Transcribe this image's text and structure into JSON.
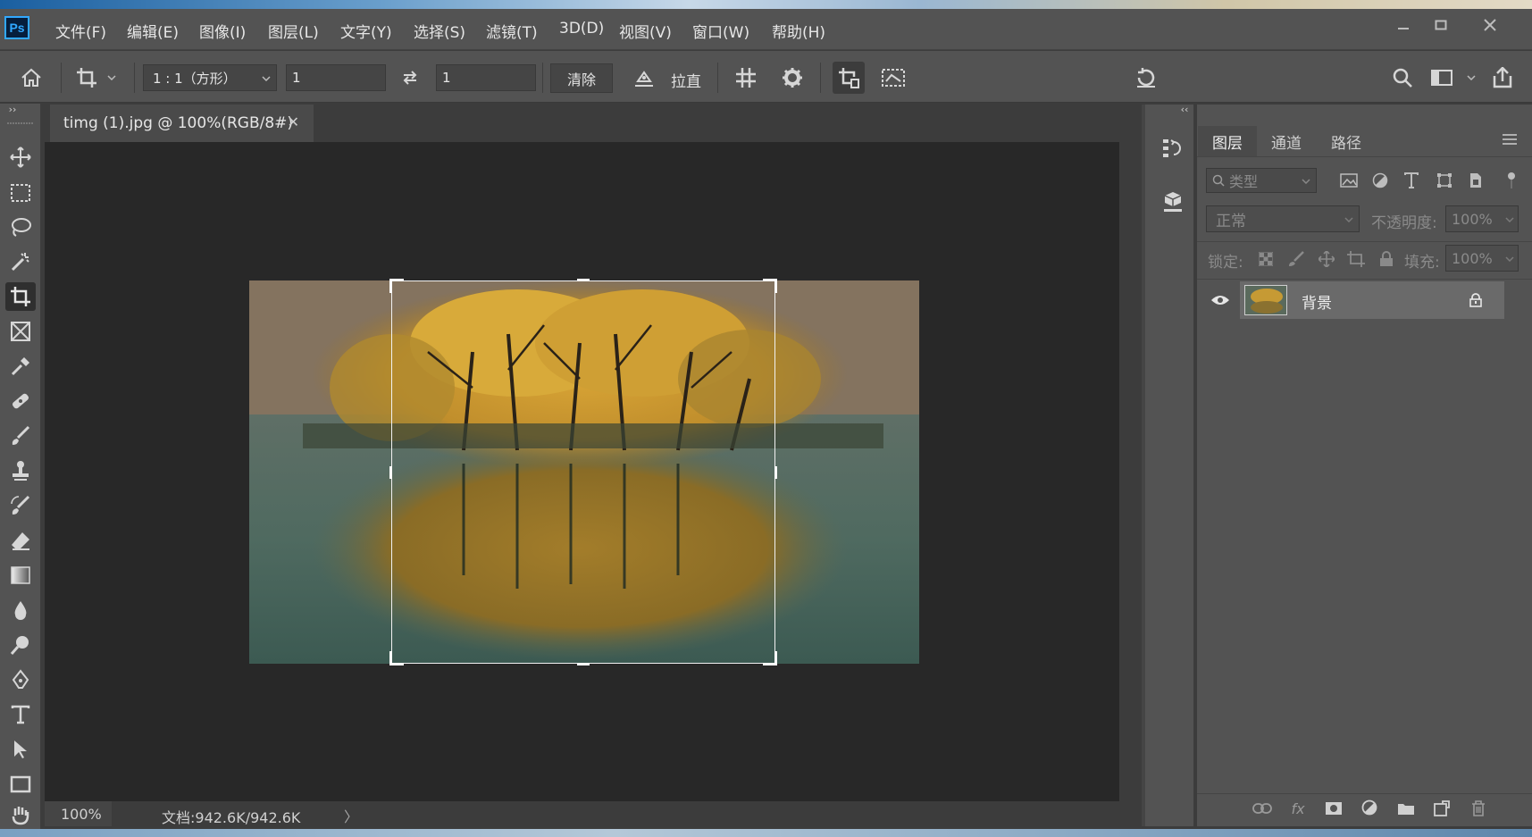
{
  "app": {
    "logo_text": "Ps"
  },
  "menu": [
    "文件(F)",
    "编辑(E)",
    "图像(I)",
    "图层(L)",
    "文字(Y)",
    "选择(S)",
    "滤镜(T)",
    "3D(D)",
    "视图(V)",
    "窗口(W)",
    "帮助(H)"
  ],
  "options_bar": {
    "ratio_preset": "1 : 1（方形）",
    "width_value": "1",
    "height_value": "1",
    "clear_label": "清除",
    "straighten_label": "拉直"
  },
  "document": {
    "tab_title": "timg (1).jpg @ 100%(RGB/8#)",
    "zoom": "100%",
    "doc_info": "文档:942.6K/942.6K"
  },
  "panel": {
    "tabs": [
      "图层",
      "通道",
      "路径"
    ],
    "active_tab": "图层",
    "filter_placeholder": "类型",
    "blend_mode": "正常",
    "opacity_label": "不透明度:",
    "opacity_value": "100%",
    "lock_label": "锁定:",
    "fill_label": "填充:",
    "fill_value": "100%",
    "layers": [
      {
        "name": "背景",
        "visible": true,
        "locked": true
      }
    ]
  },
  "colors": {
    "accent": "#31a8ff",
    "ui_dark": "#3c3c3c",
    "ui_mid": "#535353",
    "canvas_bg": "#282828"
  }
}
